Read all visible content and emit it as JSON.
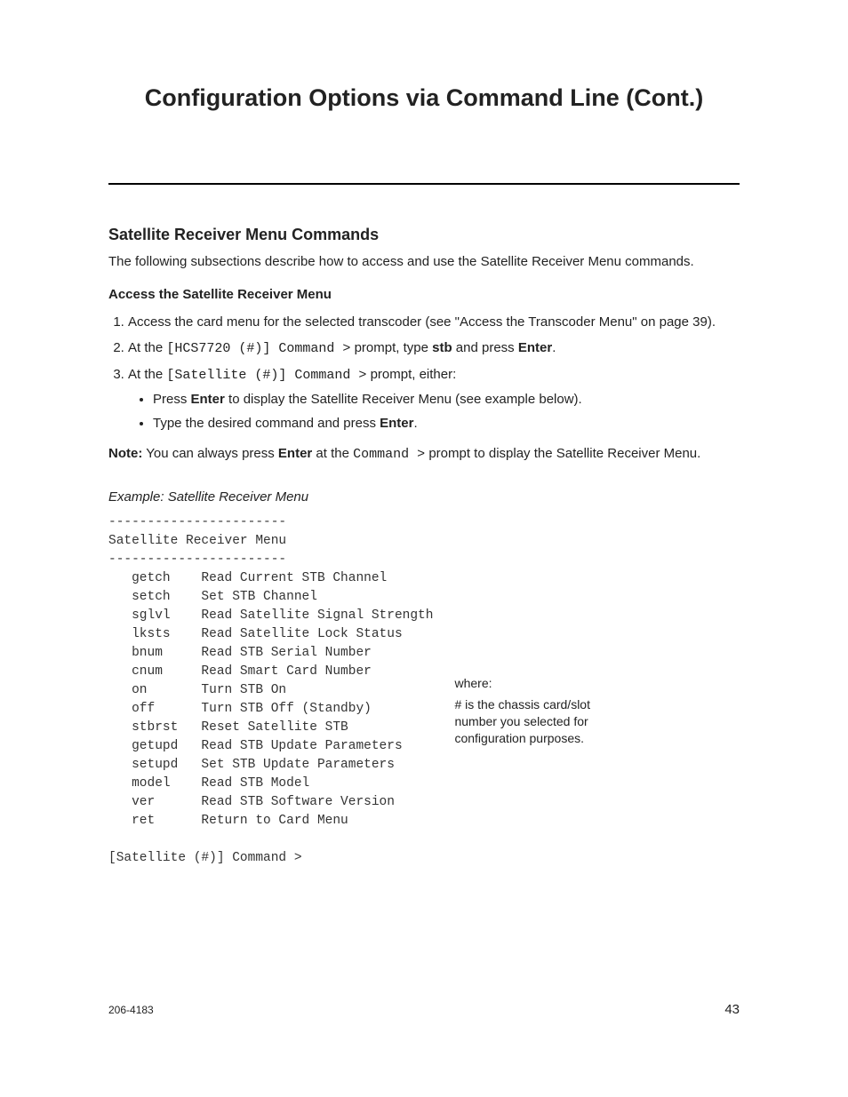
{
  "page_title": "Configuration Options via Command Line (Cont.)",
  "section_title": "Satellite Receiver Menu Commands",
  "intro": "The following subsections describe how to access and use the Satellite Receiver Menu commands.",
  "sub_title": "Access the Satellite Receiver Menu",
  "step1": "Access the card menu for the selected transcoder (see \"Access the Transcoder Menu\" on page 39).",
  "step2_pre": "At the ",
  "step2_code": "[HCS7720 (#)] Command >",
  "step2_mid": " prompt, type ",
  "step2_cmd": "stb",
  "step2_mid2": " and press ",
  "step2_enter": "Enter",
  "step2_end": ".",
  "step3_pre": "At the ",
  "step3_code": "[Satellite (#)] Command >",
  "step3_post": " prompt, either:",
  "bullet1_pre": "Press ",
  "bullet1_enter": "Enter",
  "bullet1_post": " to display the Satellite Receiver Menu (see example below).",
  "bullet2_pre": "Type the desired command and press ",
  "bullet2_enter": "Enter",
  "bullet2_post": ".",
  "note_label": "Note:",
  "note_pre": " You can always press ",
  "note_enter": "Enter",
  "note_mid": " at the ",
  "note_code": "Command >",
  "note_post": " prompt to display the Satellite Receiver Menu.",
  "example_label": "Example: Satellite Receiver Menu",
  "menu_text": "-----------------------\nSatellite Receiver Menu\n-----------------------\n   getch    Read Current STB Channel\n   setch    Set STB Channel\n   sglvl    Read Satellite Signal Strength\n   lksts    Read Satellite Lock Status\n   bnum     Read STB Serial Number\n   cnum     Read Smart Card Number\n   on       Turn STB On\n   off      Turn STB Off (Standby)\n   stbrst   Reset Satellite STB\n   getupd   Read STB Update Parameters\n   setupd   Set STB Update Parameters\n   model    Read STB Model\n   ver      Read STB Software Version\n   ret      Return to Card Menu\n\n[Satellite (#)] Command >",
  "annotation_where": "where:",
  "annotation_text": "# is the chassis card/slot number you selected for configuration purposes.",
  "footer_left": "206-4183",
  "footer_right": "43"
}
